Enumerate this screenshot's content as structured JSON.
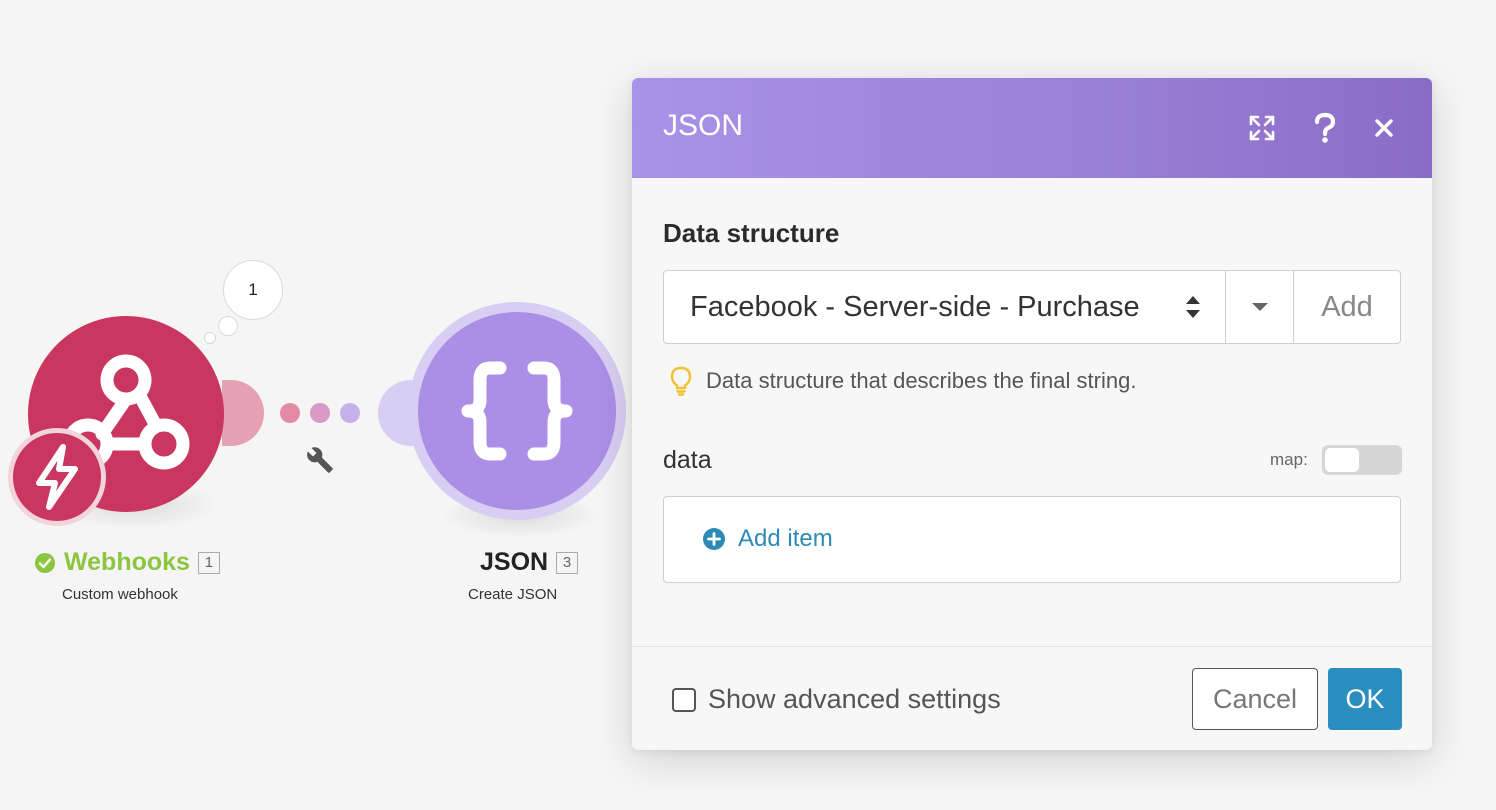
{
  "colors": {
    "webhook_red": "#c9365f",
    "json_purple": "#ab8fe6",
    "dialog_header": "#a893e8",
    "ok_blue": "#2a8ec1",
    "success_green": "#8cc63f",
    "link_blue": "#2d8ab5"
  },
  "canvas": {
    "bubble_count": "1",
    "webhook": {
      "title": "Webhooks",
      "index": "1",
      "subtitle": "Custom webhook",
      "status_icon": "check-circle-icon",
      "icon": "webhook-icon",
      "badge_icon": "lightning-icon"
    },
    "json_module": {
      "title": "JSON",
      "index": "3",
      "subtitle": "Create JSON",
      "icon": "curly-braces-icon"
    },
    "connector_icon": "wrench-icon"
  },
  "dialog": {
    "title": "JSON",
    "header_icons": [
      "expand-icon",
      "help-icon",
      "close-icon"
    ],
    "data_structure": {
      "label": "Data structure",
      "selected_value": "Facebook - Server-side - Purchase",
      "add_label": "Add",
      "hint": "Data structure that describes the final string."
    },
    "data_field": {
      "label": "data",
      "map_label": "map:",
      "map_enabled": false,
      "add_item_label": "Add item"
    },
    "footer": {
      "advanced_label": "Show advanced settings",
      "advanced_checked": false,
      "cancel_label": "Cancel",
      "ok_label": "OK"
    }
  }
}
